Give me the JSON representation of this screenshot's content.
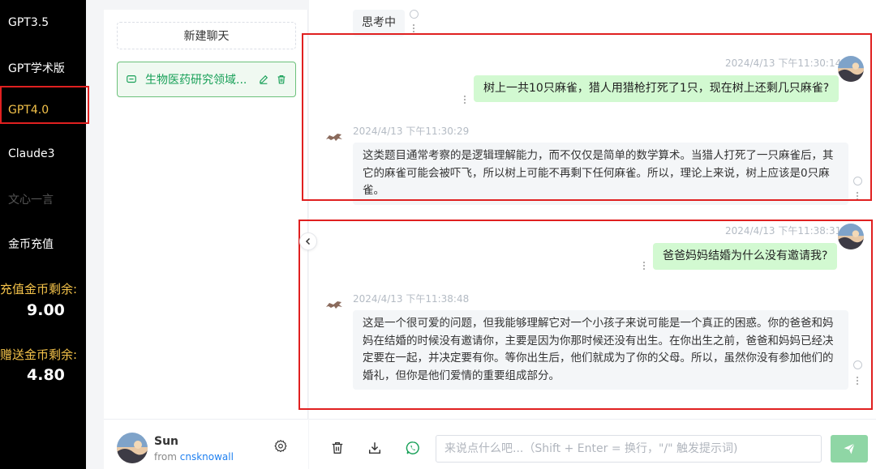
{
  "nav": {
    "items": [
      {
        "label": "GPT3.5",
        "state": "normal"
      },
      {
        "label": "GPT学术版",
        "state": "normal"
      },
      {
        "label": "GPT4.0",
        "state": "active"
      },
      {
        "label": "Claude3",
        "state": "normal"
      },
      {
        "label": "文心一言",
        "state": "disabled"
      },
      {
        "label": "金币充值",
        "state": "normal"
      }
    ],
    "recharge_coins_label": "充值金币剩余:",
    "recharge_coins_value": "9.00",
    "gift_coins_label": "赠送金币剩余:",
    "gift_coins_value": "4.80"
  },
  "conversations": {
    "new_chat_label": "新建聊天",
    "items": [
      {
        "title": "生物医药研究领域...",
        "active": true
      }
    ]
  },
  "user": {
    "name": "Sun",
    "from_prefix": "from",
    "from_link": "cnsknowall"
  },
  "chat": {
    "thinking_label": "思考中",
    "messages": [
      {
        "role": "user",
        "time": "2024/4/13 下午11:30:14",
        "text": "树上一共10只麻雀，猎人用猎枪打死了1只，现在树上还剩几只麻雀?"
      },
      {
        "role": "assistant",
        "time": "2024/4/13 下午11:30:29",
        "text": "这类题目通常考察的是逻辑理解能力，而不仅仅是简单的数学算术。当猎人打死了一只麻雀后，其它的麻雀可能会被吓飞，所以树上可能不再剩下任何麻雀。所以，理论上来说，树上应该是0只麻雀。"
      },
      {
        "role": "user",
        "time": "2024/4/13 下午11:38:31",
        "text": "爸爸妈妈结婚为什么没有邀请我?"
      },
      {
        "role": "assistant",
        "time": "2024/4/13 下午11:38:48",
        "text": "这是一个很可爱的问题，但我能够理解它对一个小孩子来说可能是一个真正的困惑。你的爸爸和妈妈在结婚的时候没有邀请你，主要是因为你那时候还没有出生。在你出生之前，爸爸和妈妈已经决定要在一起，并决定要有你。等你出生后，他们就成为了你的父母。所以，虽然你没有参加他们的婚礼，但你是他们爱情的重要组成部分。"
      }
    ]
  },
  "input": {
    "placeholder": "来说点什么吧...（Shift + Enter = 换行，\"/\" 触发提示词)"
  },
  "colors": {
    "accent_green": "#18a058",
    "user_bubble": "#d2f9d1",
    "highlight_red": "#e02020",
    "coin_gold": "#f5c34a"
  }
}
